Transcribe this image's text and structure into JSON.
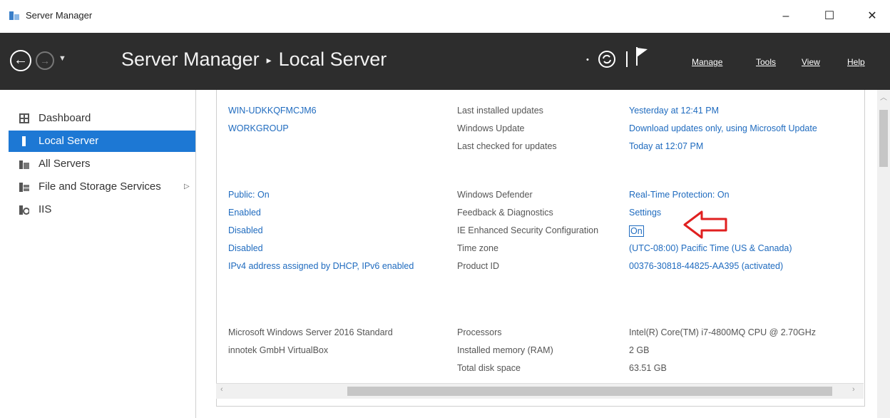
{
  "window": {
    "title": "Server Manager",
    "minimize_glyph": "–",
    "maximize_glyph": "☐",
    "close_glyph": "✕"
  },
  "header": {
    "breadcrumb_root": "Server Manager",
    "breadcrumb_sep": "▸",
    "breadcrumb_current": "Local Server",
    "menus": [
      "Manage",
      "Tools",
      "View",
      "Help"
    ]
  },
  "sidebar": {
    "items": [
      {
        "label": "Dashboard",
        "icon": "dashboard-icon"
      },
      {
        "label": "Local Server",
        "icon": "server-icon",
        "active": true
      },
      {
        "label": "All Servers",
        "icon": "servers-icon"
      },
      {
        "label": "File and Storage Services",
        "icon": "storage-icon",
        "has_submenu": true
      },
      {
        "label": "IIS",
        "icon": "iis-icon"
      }
    ]
  },
  "properties": {
    "computer_name": "WIN-UDKKQFMCJM6",
    "workgroup": "WORKGROUP",
    "firewall": "Public: On",
    "remote_management": "Enabled",
    "remote_desktop": "Disabled",
    "nic_teaming": "Disabled",
    "ethernet": "IPv4 address assigned by DHCP, IPv6 enabled",
    "os_version": "Microsoft Windows Server 2016 Standard",
    "hardware": "innotek GmbH VirtualBox",
    "last_installed_updates_label": "Last installed updates",
    "windows_update_label": "Windows Update",
    "last_checked_label": "Last checked for updates",
    "last_installed_updates": "Yesterday at 12:41 PM",
    "windows_update": "Download updates only, using Microsoft Update",
    "last_checked": "Today at 12:07 PM",
    "defender_label": "Windows Defender",
    "feedback_label": "Feedback & Diagnostics",
    "ie_esc_label": "IE Enhanced Security Configuration",
    "time_zone_label": "Time zone",
    "product_id_label": "Product ID",
    "defender": "Real-Time Protection: On",
    "feedback": "Settings",
    "ie_esc": "On",
    "time_zone": "(UTC-08:00) Pacific Time (US & Canada)",
    "product_id": "00376-30818-44825-AA395 (activated)",
    "processors_label": "Processors",
    "memory_label": "Installed memory (RAM)",
    "disk_label": "Total disk space",
    "processors": "Intel(R) Core(TM) i7-4800MQ CPU @ 2.70GHz",
    "memory": "2 GB",
    "disk": "63.51 GB"
  },
  "colors": {
    "header_bg": "#2d2d2d",
    "active_item": "#1d78d4",
    "link": "#1f6bbf",
    "annotation_arrow": "#e02020"
  }
}
